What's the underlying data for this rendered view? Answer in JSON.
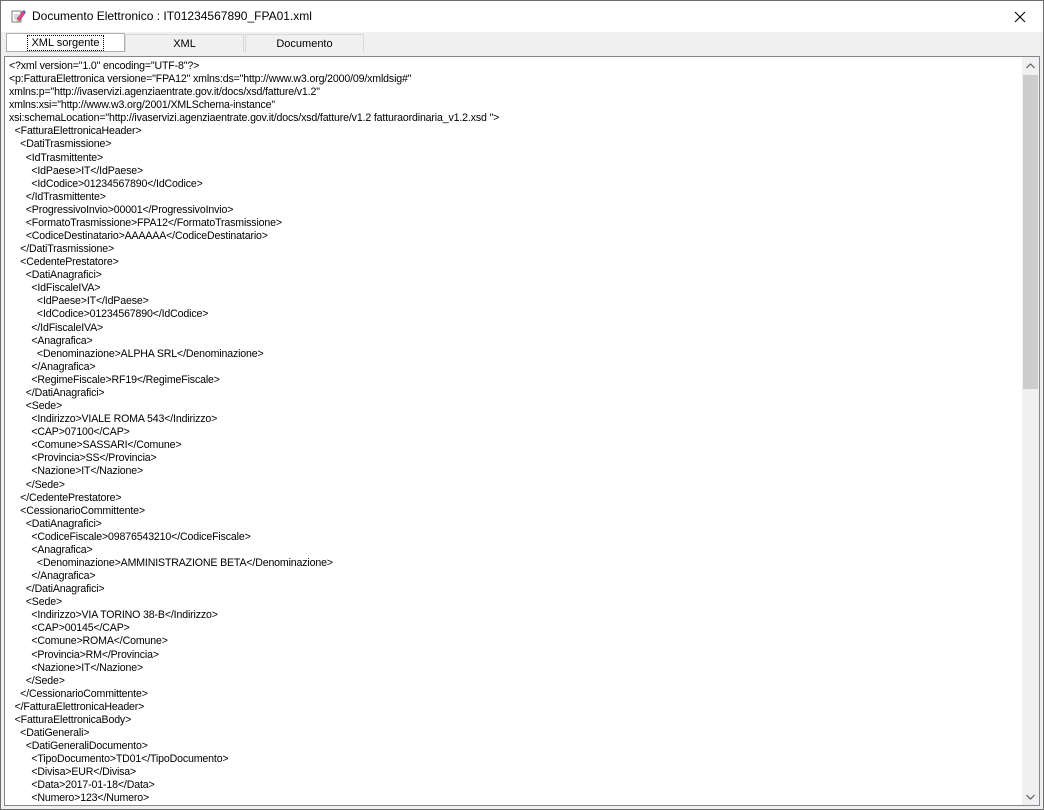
{
  "window": {
    "title": "Documento Elettronico : IT01234567890_FPA01.xml"
  },
  "tabs": [
    {
      "label": "XML sorgente",
      "active": true
    },
    {
      "label": "XML",
      "active": false
    },
    {
      "label": "Documento",
      "active": false
    }
  ],
  "xml_lines": [
    "<?xml version=\"1.0\" encoding=\"UTF-8\"?>",
    "<p:FatturaElettronica versione=\"FPA12\" xmlns:ds=\"http://www.w3.org/2000/09/xmldsig#\"",
    "xmlns:p=\"http://ivaservizi.agenziaentrate.gov.it/docs/xsd/fatture/v1.2\"",
    "xmlns:xsi=\"http://www.w3.org/2001/XMLSchema-instance\"",
    "xsi:schemaLocation=\"http://ivaservizi.agenziaentrate.gov.it/docs/xsd/fatture/v1.2 fatturaordinaria_v1.2.xsd \">",
    "  <FatturaElettronicaHeader>",
    "    <DatiTrasmissione>",
    "      <IdTrasmittente>",
    "        <IdPaese>IT</IdPaese>",
    "        <IdCodice>01234567890</IdCodice>",
    "      </IdTrasmittente>",
    "      <ProgressivoInvio>00001</ProgressivoInvio>",
    "      <FormatoTrasmissione>FPA12</FormatoTrasmissione>",
    "      <CodiceDestinatario>AAAAAA</CodiceDestinatario>",
    "    </DatiTrasmissione>",
    "    <CedentePrestatore>",
    "      <DatiAnagrafici>",
    "        <IdFiscaleIVA>",
    "          <IdPaese>IT</IdPaese>",
    "          <IdCodice>01234567890</IdCodice>",
    "        </IdFiscaleIVA>",
    "        <Anagrafica>",
    "          <Denominazione>ALPHA SRL</Denominazione>",
    "        </Anagrafica>",
    "        <RegimeFiscale>RF19</RegimeFiscale>",
    "      </DatiAnagrafici>",
    "      <Sede>",
    "        <Indirizzo>VIALE ROMA 543</Indirizzo>",
    "        <CAP>07100</CAP>",
    "        <Comune>SASSARI</Comune>",
    "        <Provincia>SS</Provincia>",
    "        <Nazione>IT</Nazione>",
    "      </Sede>",
    "    </CedentePrestatore>",
    "    <CessionarioCommittente>",
    "      <DatiAnagrafici>",
    "        <CodiceFiscale>09876543210</CodiceFiscale>",
    "        <Anagrafica>",
    "          <Denominazione>AMMINISTRAZIONE BETA</Denominazione>",
    "        </Anagrafica>",
    "      </DatiAnagrafici>",
    "      <Sede>",
    "        <Indirizzo>VIA TORINO 38-B</Indirizzo>",
    "        <CAP>00145</CAP>",
    "        <Comune>ROMA</Comune>",
    "        <Provincia>RM</Provincia>",
    "        <Nazione>IT</Nazione>",
    "      </Sede>",
    "    </CessionarioCommittente>",
    "  </FatturaElettronicaHeader>",
    "  <FatturaElettronicaBody>",
    "    <DatiGenerali>",
    "      <DatiGeneraliDocumento>",
    "        <TipoDocumento>TD01</TipoDocumento>",
    "        <Divisa>EUR</Divisa>",
    "        <Data>2017-01-18</Data>",
    "        <Numero>123</Numero>"
  ]
}
